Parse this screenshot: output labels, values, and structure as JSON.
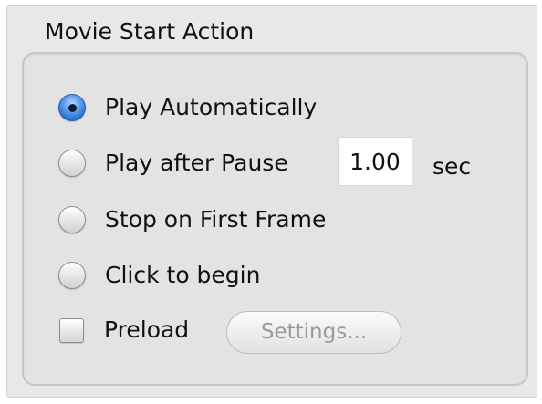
{
  "group": {
    "title": "Movie Start Action"
  },
  "options": [
    {
      "label": "Play Automatically",
      "selected": true
    },
    {
      "label": "Play after Pause",
      "selected": false
    },
    {
      "label": "Stop on First Frame",
      "selected": false
    },
    {
      "label": "Click to begin",
      "selected": false
    }
  ],
  "pause": {
    "value": "1.00",
    "unit": "sec"
  },
  "preload": {
    "label": "Preload",
    "checked": false
  },
  "settings_button": {
    "label": "Settings...",
    "enabled": false
  },
  "colors": {
    "selected_radio": "#2b6ccf",
    "disabled_text": "#9a9a9a"
  }
}
